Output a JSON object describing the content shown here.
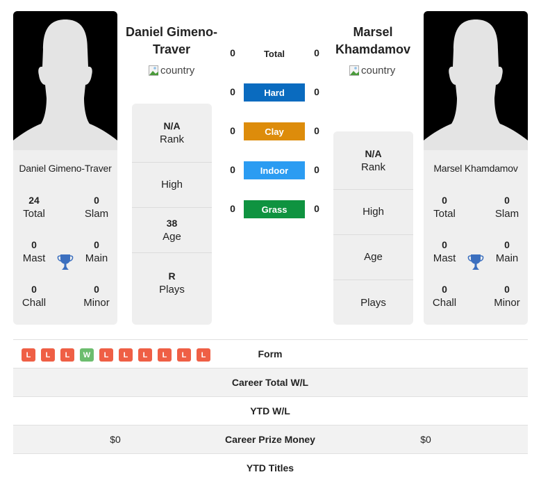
{
  "colors": {
    "hard": "#0a6bbf",
    "clay": "#dd8c0b",
    "indoor": "#2b9cf2",
    "grass": "#0f9340",
    "loss": "#ef5f45",
    "win": "#6cbd6e",
    "trophy": "#3b6fbf"
  },
  "player1": {
    "name": "Daniel Gimeno-Traver",
    "name_line1": "Daniel Gimeno-",
    "name_line2": "Traver",
    "flag_alt": "country",
    "card_name": "Daniel Gimeno-Traver",
    "titles": {
      "total": {
        "value": "24",
        "label": "Total"
      },
      "slam": {
        "value": "0",
        "label": "Slam"
      },
      "mast": {
        "value": "0",
        "label": "Mast"
      },
      "main": {
        "value": "0",
        "label": "Main"
      },
      "chall": {
        "value": "0",
        "label": "Chall"
      },
      "minor": {
        "value": "0",
        "label": "Minor"
      }
    },
    "stats": {
      "rank": {
        "value": "N/A",
        "label": "Rank"
      },
      "high": {
        "value": "",
        "label": "High"
      },
      "age": {
        "value": "38",
        "label": "Age"
      },
      "plays": {
        "value": "R",
        "label": "Plays"
      }
    }
  },
  "player2": {
    "name": "Marsel Khamdamov",
    "name_line1": "Marsel",
    "name_line2": "Khamdamov",
    "flag_alt": "country",
    "card_name": "Marsel Khamdamov",
    "titles": {
      "total": {
        "value": "0",
        "label": "Total"
      },
      "slam": {
        "value": "0",
        "label": "Slam"
      },
      "mast": {
        "value": "0",
        "label": "Mast"
      },
      "main": {
        "value": "0",
        "label": "Main"
      },
      "chall": {
        "value": "0",
        "label": "Chall"
      },
      "minor": {
        "value": "0",
        "label": "Minor"
      }
    },
    "stats": {
      "rank": {
        "value": "N/A",
        "label": "Rank"
      },
      "high": {
        "value": "",
        "label": "High"
      },
      "age": {
        "value": "",
        "label": "Age"
      },
      "plays": {
        "value": "",
        "label": "Plays"
      }
    }
  },
  "h2h": {
    "total": {
      "label": "Total",
      "p1": "0",
      "p2": "0"
    },
    "surfaces": [
      {
        "label": "Hard",
        "p1": "0",
        "p2": "0",
        "color_key": "hard"
      },
      {
        "label": "Clay",
        "p1": "0",
        "p2": "0",
        "color_key": "clay"
      },
      {
        "label": "Indoor",
        "p1": "0",
        "p2": "0",
        "color_key": "indoor"
      },
      {
        "label": "Grass",
        "p1": "0",
        "p2": "0",
        "color_key": "grass"
      }
    ]
  },
  "comparison": {
    "form": {
      "label": "Form",
      "p1": [
        "L",
        "L",
        "L",
        "W",
        "L",
        "L",
        "L",
        "L",
        "L",
        "L"
      ]
    },
    "rows": [
      {
        "label": "Career Total W/L",
        "p1": "",
        "p2": ""
      },
      {
        "label": "YTD W/L",
        "p1": "",
        "p2": ""
      },
      {
        "label": "Career Prize Money",
        "p1": "$0",
        "p2": "$0"
      },
      {
        "label": "YTD Titles",
        "p1": "",
        "p2": ""
      }
    ]
  }
}
